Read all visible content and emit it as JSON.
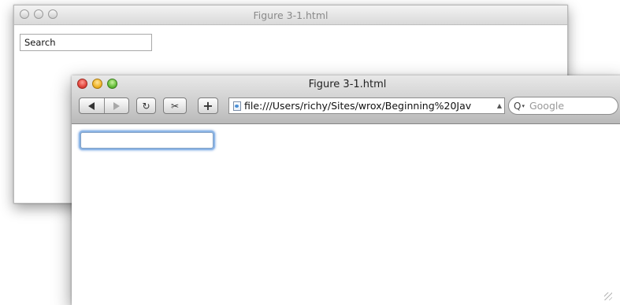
{
  "back_window": {
    "title": "Figure 3-1.html",
    "search_field": {
      "value": "Search"
    }
  },
  "front_window": {
    "title": "Figure 3-1.html",
    "toolbar": {
      "back_icon": "triangle-left",
      "forward_icon": "triangle-right",
      "reload_icon": "↻",
      "snip_icon": "✂",
      "add_bookmark_label": "+",
      "address": "file:///Users/richy/Sites/wrox/Beginning%20Jav",
      "address_dropdown_icon": "▲",
      "search_icon": "Q",
      "search_caret": "▾",
      "search_placeholder": "Google"
    },
    "content": {
      "text_input_value": ""
    }
  },
  "colors": {
    "close": "#e2463d",
    "minimize": "#f0b52a",
    "zoom": "#66bf3a",
    "focus_ring": "#8db6e7"
  }
}
